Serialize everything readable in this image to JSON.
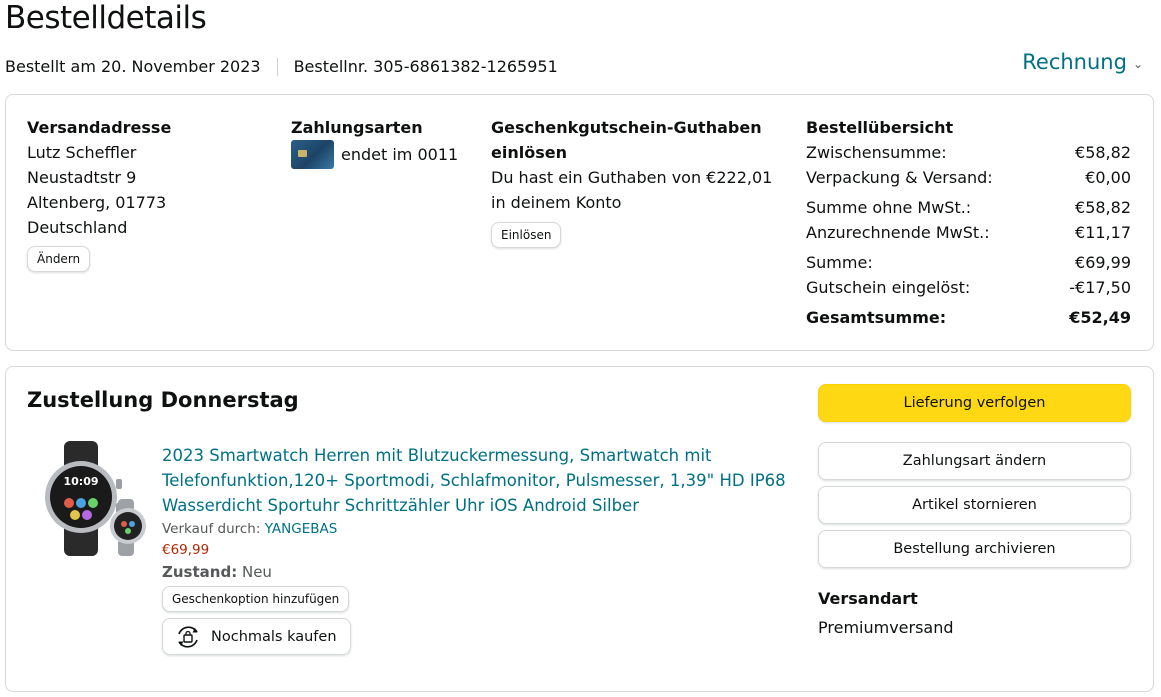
{
  "header": {
    "title": "Bestelldetails",
    "ordered_on": "Bestellt am 20. November 2023",
    "order_number": "Bestellnr. 305-6861382-1265951",
    "invoice_label": "Rechnung"
  },
  "address": {
    "heading": "Versandadresse",
    "name": "Lutz Scheffler",
    "street": "Neustadtstr 9",
    "city": "Altenberg, 01773",
    "country": "Deutschland",
    "change_label": "Ändern"
  },
  "payment": {
    "heading": "Zahlungsarten",
    "card_text": "endet im 0011"
  },
  "gift": {
    "heading": "Geschenkgutschein-Guthaben einlösen",
    "text": "Du hast ein Guthaben von €222,01 in deinem Konto",
    "redeem_label": "Einlösen"
  },
  "summary": {
    "heading": "Bestellübersicht",
    "subtotal_label": "Zwischensumme:",
    "subtotal": "€58,82",
    "shipping_label": "Verpackung & Versand:",
    "shipping": "€0,00",
    "net_label": "Summe ohne MwSt.:",
    "net": "€58,82",
    "vat_label": "Anzurechnende MwSt.:",
    "vat": "€11,17",
    "sum_label": "Summe:",
    "sum": "€69,99",
    "voucher_label": "Gutschein eingelöst:",
    "voucher": "-€17,50",
    "total_label": "Gesamtsumme:",
    "total": "€52,49"
  },
  "shipment": {
    "title": "Zustellung Donnerstag",
    "product_title": "2023 Smartwatch Herren mit Blutzuckermessung, Smartwatch mit Telefonfunktion,120+ Sportmodi, Schlafmonitor, Pulsmesser, 1,39\" HD IP68 Wasserdicht Sportuhr Schrittzähler Uhr iOS Android Silber",
    "seller_label": "Verkauf durch:",
    "seller": "YANGEBAS",
    "price": "€69,99",
    "condition_label": "Zustand:",
    "condition": "Neu",
    "gift_option_label": "Geschenkoption hinzufügen",
    "buy_again_label": "Nochmals kaufen",
    "watch_time": "10:09"
  },
  "actions": {
    "track": "Lieferung verfolgen",
    "change_payment": "Zahlungsart ändern",
    "cancel": "Artikel stornieren",
    "archive": "Bestellung archivieren",
    "ship_method_heading": "Versandart",
    "ship_method": "Premiumversand"
  },
  "colors": {
    "link": "#007185",
    "primary_button": "#ffd814",
    "price": "#b12704"
  }
}
